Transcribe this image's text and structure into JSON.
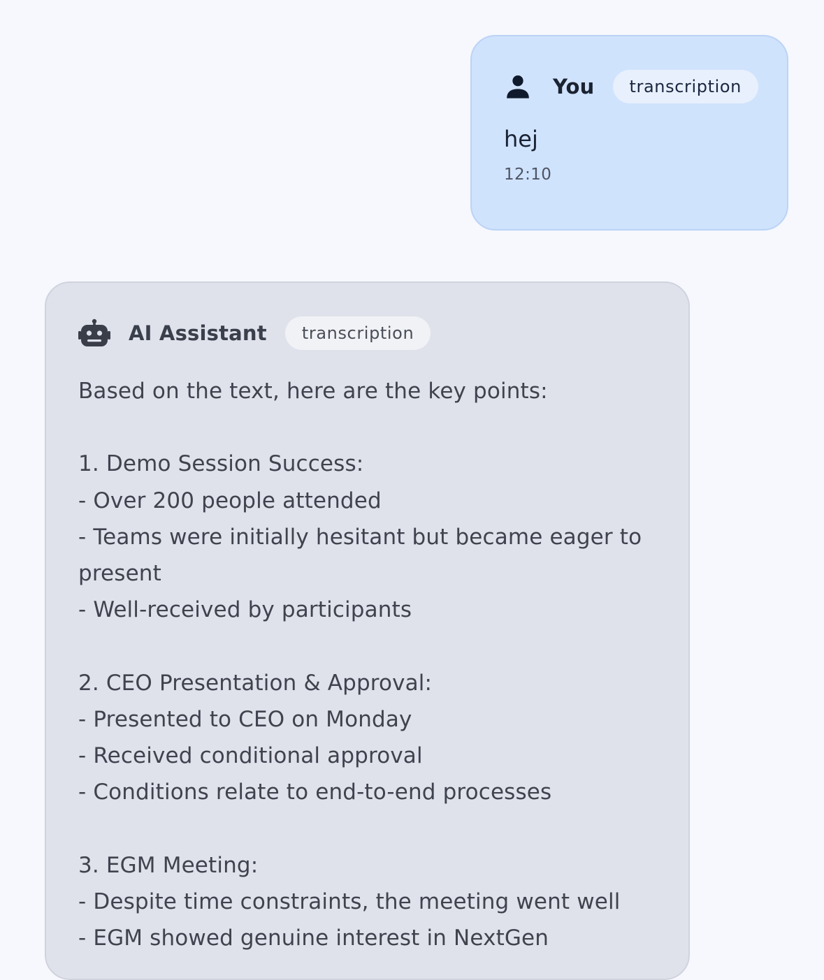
{
  "messages": {
    "user": {
      "sender": "You",
      "badge": "transcription",
      "text": "hej",
      "time": "12:10",
      "icon": "person-icon"
    },
    "assistant": {
      "sender": "AI Assistant",
      "badge": "transcription",
      "icon": "robot-icon",
      "text": "Based on the text, here are the key points:\n\n1. Demo Session Success:\n- Over 200 people attended\n- Teams were initially hesitant but became eager to present\n- Well-received by participants\n\n2. CEO Presentation & Approval:\n- Presented to CEO on Monday\n- Received conditional approval\n- Conditions relate to end-to-end processes\n\n3. EGM Meeting:\n- Despite time constraints, the meeting went well\n- EGM showed genuine interest in NextGen"
    }
  },
  "colors": {
    "page_background": "#f6f8fd",
    "user_bubble": "#d0e3fd",
    "assistant_bubble": "#e0e2eb"
  }
}
